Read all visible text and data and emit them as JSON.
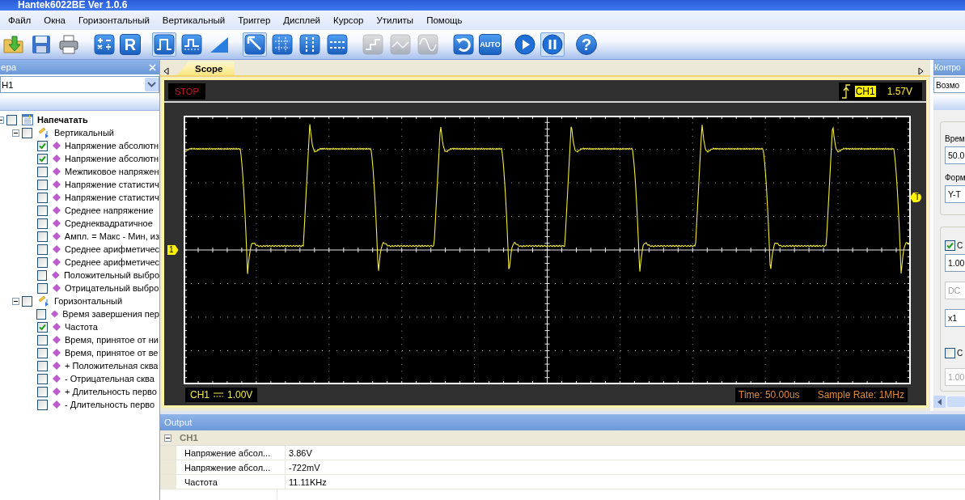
{
  "window": {
    "title": "Hantek6022BE Ver 1.0.6"
  },
  "menu": [
    "Файл",
    "Окна",
    "Горизонтальный",
    "Вертикальный",
    "Триггер",
    "Дисплей",
    "Курсор",
    "Утилиты",
    "Помощь"
  ],
  "toolbar": [
    {
      "kind": "import",
      "selected": false,
      "disabled": false
    },
    {
      "kind": "save",
      "selected": false,
      "disabled": false
    },
    {
      "kind": "print",
      "selected": false,
      "disabled": false
    },
    {
      "kind": "math",
      "selected": false,
      "disabled": false
    },
    {
      "kind": "ref",
      "label": "R",
      "selected": false,
      "disabled": false
    },
    {
      "kind": "square",
      "selected": true,
      "disabled": false
    },
    {
      "kind": "pulse",
      "selected": false,
      "disabled": false
    },
    {
      "kind": "ramp",
      "selected": false,
      "disabled": false
    },
    {
      "kind": "pointer",
      "selected": true,
      "disabled": false
    },
    {
      "kind": "grid",
      "selected": false,
      "disabled": false
    },
    {
      "kind": "vcursor",
      "selected": false,
      "disabled": false
    },
    {
      "kind": "hcursor",
      "selected": false,
      "disabled": false
    },
    {
      "kind": "step",
      "selected": false,
      "disabled": true
    },
    {
      "kind": "triangle",
      "selected": false,
      "disabled": true
    },
    {
      "kind": "sine",
      "selected": false,
      "disabled": true
    },
    {
      "kind": "rotate",
      "selected": false,
      "disabled": false
    },
    {
      "kind": "auto",
      "label": "AUTO",
      "selected": false,
      "disabled": false
    },
    {
      "kind": "play",
      "selected": false,
      "disabled": false
    },
    {
      "kind": "pause",
      "selected": true,
      "disabled": false
    },
    {
      "kind": "help",
      "label": "?",
      "selected": false,
      "disabled": false
    }
  ],
  "left_panel": {
    "title": "ера",
    "channel": "H1",
    "tree": [
      {
        "label": "Напечатать",
        "kind": "root",
        "checked": false,
        "expanded": true,
        "children": [
          {
            "label": "Вертикальный",
            "kind": "group",
            "checked": false,
            "expanded": true,
            "children": [
              {
                "label": "Напряжение абсолютн",
                "kind": "measure",
                "checked": true
              },
              {
                "label": "Напряжение абсолютн",
                "kind": "measure",
                "checked": true
              },
              {
                "label": "Межпиковое напряжен",
                "kind": "measure",
                "checked": false
              },
              {
                "label": "Напряжение статистич",
                "kind": "measure",
                "checked": false
              },
              {
                "label": "Напряжение статистич",
                "kind": "measure",
                "checked": false
              },
              {
                "label": "Среднее напряжение",
                "kind": "measure",
                "checked": false
              },
              {
                "label": "Среднеквадратичное",
                "kind": "measure",
                "checked": false
              },
              {
                "label": "Ампл. = Макс - Мин, из",
                "kind": "measure",
                "checked": false
              },
              {
                "label": "Среднее арифметичес",
                "kind": "measure",
                "checked": false
              },
              {
                "label": "Среднее арифметичес",
                "kind": "measure",
                "checked": false
              },
              {
                "label": "Положительный выбро",
                "kind": "measure",
                "checked": false
              },
              {
                "label": "Отрицательный выбро",
                "kind": "measure",
                "checked": false
              }
            ]
          },
          {
            "label": "Горизонтальный",
            "kind": "group",
            "checked": false,
            "expanded": true,
            "children": [
              {
                "label": "Время завершения пер",
                "kind": "measure",
                "checked": false
              },
              {
                "label": "Частота",
                "kind": "measure",
                "checked": true
              },
              {
                "label": "Время, принятое от ни",
                "kind": "measure",
                "checked": false
              },
              {
                "label": "Время, принятое от ве",
                "kind": "measure",
                "checked": false
              },
              {
                "label": "+ Положительная сква",
                "kind": "measure",
                "checked": false
              },
              {
                "label": "- Отрицательная сква",
                "kind": "measure",
                "checked": false
              },
              {
                "label": "+ Длительность перво",
                "kind": "measure",
                "checked": false
              },
              {
                "label": "- Длительность перво",
                "kind": "measure",
                "checked": false
              }
            ]
          }
        ]
      }
    ]
  },
  "scope": {
    "tab": "Scope",
    "status": "STOP",
    "trigger_source": "CH1",
    "trigger_level": "1.57V",
    "ground_marker": "1",
    "trigger_marker": "T",
    "channel": "CH1",
    "volts_per_div": "1.00V",
    "time": "Time: 50.00us",
    "sample_rate": "Sample Rate: 1MHz"
  },
  "right_panel": {
    "title": "Контро",
    "mode": "Возмо",
    "time_label": "Врем",
    "time_value": "50.0",
    "format_label": "Форм",
    "format_value": "Y-T",
    "channels": [
      {
        "label": "C",
        "checked": true,
        "fields": [
          {
            "value": "1.00",
            "disabled": false
          },
          {
            "value": "DC",
            "disabled": true
          },
          {
            "value": "x1",
            "disabled": false
          }
        ]
      },
      {
        "label": "C",
        "checked": false,
        "fields": [
          {
            "value": "1.00",
            "disabled": true
          }
        ]
      }
    ]
  },
  "output": {
    "title": "Output",
    "groups": [
      {
        "name": "CH1",
        "expanded": true,
        "rows": [
          {
            "name": "Напряжение абсол...",
            "value": "3.86V"
          },
          {
            "name": "Напряжение абсол...",
            "value": "-722mV"
          },
          {
            "name": "Частота",
            "value": "11.11KHz"
          }
        ]
      }
    ]
  }
}
